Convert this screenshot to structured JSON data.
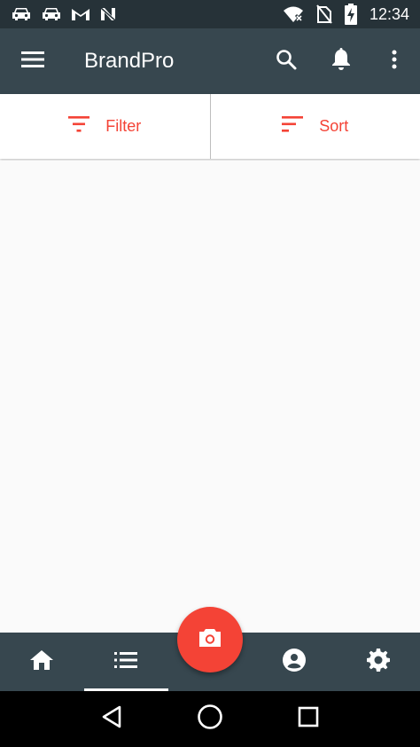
{
  "status_bar": {
    "time": "12:34",
    "icons": [
      "car-icon",
      "car-icon",
      "gmail-icon",
      "n-icon",
      "wifi-icon",
      "no-sim-icon",
      "battery-charging-icon"
    ]
  },
  "app_bar": {
    "title": "BrandPro",
    "icons": [
      "menu-icon",
      "search-icon",
      "bell-icon",
      "more-vert-icon"
    ]
  },
  "filter_bar": {
    "filter_label": "Filter",
    "sort_label": "Sort",
    "accent_color": "#f44336"
  },
  "bottom_nav": {
    "items": [
      "home-icon",
      "list-icon",
      "account-icon",
      "settings-icon"
    ],
    "active": "list-icon"
  },
  "fab": {
    "icon": "camera-icon",
    "color": "#f44336"
  },
  "system_nav": {
    "items": [
      "back-icon",
      "home-circle-icon",
      "recents-icon"
    ]
  },
  "colors": {
    "status_bar": "#263238",
    "app_bar": "#37474f",
    "background": "#fafafa"
  }
}
